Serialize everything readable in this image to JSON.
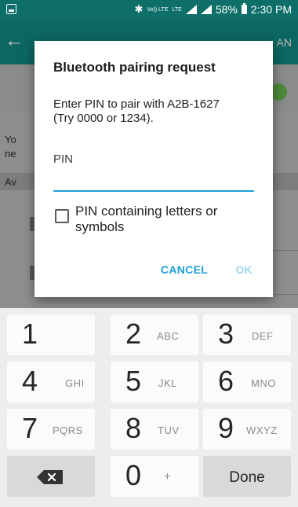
{
  "status_bar": {
    "network": "Vo)) LTE",
    "lte": "LTE",
    "battery_percent": "58%",
    "time": "2:30 PM"
  },
  "background": {
    "scan_label": "AN",
    "text_line1": "Yo",
    "text_line2": "ne",
    "section_label": "Av"
  },
  "dialog": {
    "title": "Bluetooth pairing request",
    "message": "Enter PIN to pair with A2B-1627\n(Try 0000 or 1234).",
    "pin_label": "PIN",
    "pin_value": "",
    "checkbox_label": "PIN containing letters or symbols",
    "checkbox_checked": false,
    "cancel_label": "CANCEL",
    "ok_label": "OK"
  },
  "keypad": {
    "keys": [
      {
        "num": "1",
        "letters": ""
      },
      {
        "num": "2",
        "letters": "ABC"
      },
      {
        "num": "3",
        "letters": "DEF"
      },
      {
        "num": "4",
        "letters": "GHI"
      },
      {
        "num": "5",
        "letters": "JKL"
      },
      {
        "num": "6",
        "letters": "MNO"
      },
      {
        "num": "7",
        "letters": "PQRS"
      },
      {
        "num": "8",
        "letters": "TUV"
      },
      {
        "num": "9",
        "letters": "WXYZ"
      },
      {
        "num": "0",
        "letters": "+"
      }
    ],
    "done_label": "Done",
    "delete_icon": "backspace-icon"
  },
  "colors": {
    "accent": "#1a9fd6",
    "accent_disabled": "#9fd6ee",
    "status_bar": "#0d6f68"
  }
}
